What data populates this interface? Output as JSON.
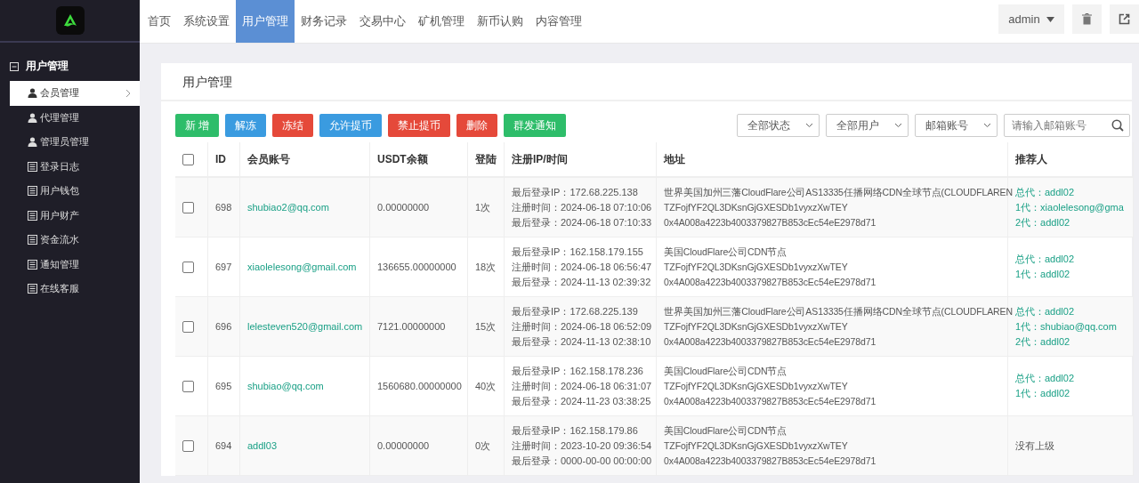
{
  "nav": {
    "items": [
      {
        "label": "首页",
        "selected": false
      },
      {
        "label": "系统设置",
        "selected": false
      },
      {
        "label": "用户管理",
        "selected": true
      },
      {
        "label": "财务记录",
        "selected": false
      },
      {
        "label": "交易中心",
        "selected": false
      },
      {
        "label": "矿机管理",
        "selected": false
      },
      {
        "label": "新币认购",
        "selected": false
      },
      {
        "label": "内容管理",
        "selected": false
      }
    ],
    "user": "admin"
  },
  "sidebar": {
    "group": "用户管理",
    "items": [
      {
        "label": "会员管理",
        "kind": "person",
        "selected": true
      },
      {
        "label": "代理管理",
        "kind": "person",
        "selected": false
      },
      {
        "label": "管理员管理",
        "kind": "person",
        "selected": false
      },
      {
        "label": "登录日志",
        "kind": "table",
        "selected": false
      },
      {
        "label": "用户钱包",
        "kind": "table",
        "selected": false
      },
      {
        "label": "用户财产",
        "kind": "table",
        "selected": false
      },
      {
        "label": "资金流水",
        "kind": "table",
        "selected": false
      },
      {
        "label": "通知管理",
        "kind": "table",
        "selected": false
      },
      {
        "label": "在线客服",
        "kind": "table",
        "selected": false
      }
    ]
  },
  "page_title": "用户管理",
  "actions": [
    {
      "label": "新 增",
      "color": "#2ebd6a"
    },
    {
      "label": "解冻",
      "color": "#3a9be0"
    },
    {
      "label": "冻结",
      "color": "#e5493a"
    },
    {
      "label": "允许提币",
      "color": "#3a9be0"
    },
    {
      "label": "禁止提币",
      "color": "#e5493a"
    },
    {
      "label": "删除",
      "color": "#e5493a"
    },
    {
      "label": "群发通知",
      "color": "#2ebd6a"
    }
  ],
  "filters": [
    "全部状态",
    "全部用户",
    "邮箱账号"
  ],
  "search": {
    "placeholder": "请输入邮箱账号"
  },
  "table": {
    "select_all_checked": false,
    "columns": [
      "ID",
      "会员账号",
      "USDT余额",
      "登陆",
      "注册IP/时间",
      "地址",
      "推荐人"
    ],
    "rows": [
      {
        "checked": false,
        "id": "698",
        "account": "shubiao2@qq.com",
        "usdt": "0.00000000",
        "logins": "1次",
        "ip_time": [
          "最后登录IP：172.68.225.138",
          "注册时间：2024-06-18 07:10:06",
          "最后登录：2024-06-18 07:10:33"
        ],
        "address": [
          "世界美国加州三藩CloudFlare公司AS13335任播网络CDN全球节点(CLOUDFLAREN",
          "TZFojfYF2QL3DKsnGjGXESDb1vyxzXwTEY",
          "0x4A008a4223b4003379827B853cEc54eE2978d71"
        ],
        "referrer": {
          "linked": true,
          "lines": [
            "总代：addl02",
            "1代：xiaolelesong@gma",
            "2代：addl02"
          ]
        }
      },
      {
        "checked": false,
        "id": "697",
        "account": "xiaolelesong@gmail.com",
        "usdt": "136655.00000000",
        "logins": "18次",
        "ip_time": [
          "最后登录IP：162.158.179.155",
          "注册时间：2024-06-18 06:56:47",
          "最后登录：2024-11-13 02:39:32"
        ],
        "address": [
          "美国CloudFlare公司CDN节点",
          "TZFojfYF2QL3DKsnGjGXESDb1vyxzXwTEY",
          "0x4A008a4223b4003379827B853cEc54eE2978d71"
        ],
        "referrer": {
          "linked": true,
          "lines": [
            "总代：addl02",
            "1代：addl02"
          ]
        }
      },
      {
        "checked": false,
        "id": "696",
        "account": "lelesteven520@gmail.com",
        "usdt": "7121.00000000",
        "logins": "15次",
        "ip_time": [
          "最后登录IP：172.68.225.139",
          "注册时间：2024-06-18 06:52:09",
          "最后登录：2024-11-13 02:38:10"
        ],
        "address": [
          "世界美国加州三藩CloudFlare公司AS13335任播网络CDN全球节点(CLOUDFLAREN",
          "TZFojfYF2QL3DKsnGjGXESDb1vyxzXwTEY",
          "0x4A008a4223b4003379827B853cEc54eE2978d71"
        ],
        "referrer": {
          "linked": true,
          "lines": [
            "总代：addl02",
            "1代：shubiao@qq.com",
            "2代：addl02"
          ]
        }
      },
      {
        "checked": false,
        "id": "695",
        "account": "shubiao@qq.com",
        "usdt": "1560680.00000000",
        "logins": "40次",
        "ip_time": [
          "最后登录IP：162.158.178.236",
          "注册时间：2024-06-18 06:31:07",
          "最后登录：2024-11-23 03:38:25"
        ],
        "address": [
          "美国CloudFlare公司CDN节点",
          "TZFojfYF2QL3DKsnGjGXESDb1vyxzXwTEY",
          "0x4A008a4223b4003379827B853cEc54eE2978d71"
        ],
        "referrer": {
          "linked": true,
          "lines": [
            "总代：addl02",
            "1代：addl02"
          ]
        }
      },
      {
        "checked": false,
        "id": "694",
        "account": "addl03",
        "usdt": "0.00000000",
        "logins": "0次",
        "ip_time": [
          "最后登录IP：162.158.179.86",
          "注册时间：2023-10-20 09:36:54",
          "最后登录：0000-00-00 00:00:00"
        ],
        "address": [
          "美国CloudFlare公司CDN节点",
          "TZFojfYF2QL3DKsnGjGXESDb1vyxzXwTEY",
          "0x4A008a4223b4003379827B853cEc54eE2978d71"
        ],
        "referrer": {
          "linked": false,
          "lines": [
            "没有上级"
          ]
        }
      }
    ]
  }
}
